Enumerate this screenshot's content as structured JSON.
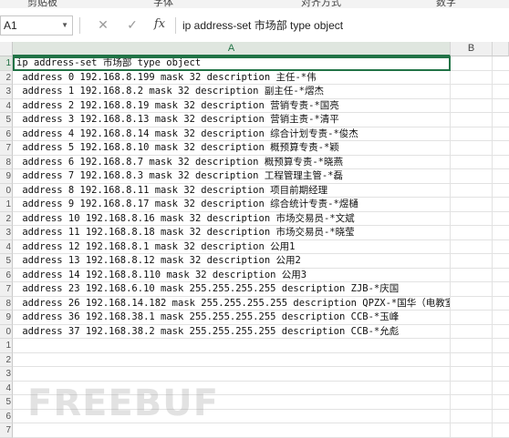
{
  "ribbon": {
    "fragments": [
      "剪贴板",
      "字体",
      "对齐方式",
      "数字"
    ]
  },
  "formula_bar": {
    "name_box": "A1",
    "formula": "ip address-set 市场部 type object"
  },
  "columns": [
    "A",
    "B"
  ],
  "rows": [
    {
      "num": "1",
      "a": "ip address-set 市场部 type object"
    },
    {
      "num": "2",
      "a": " address 0 192.168.8.199 mask 32 description 主任-*伟"
    },
    {
      "num": "3",
      "a": " address 1 192.168.8.2 mask 32 description 副主任-*熠杰"
    },
    {
      "num": "4",
      "a": " address 2 192.168.8.19 mask 32 description 营销专责-*国亮"
    },
    {
      "num": "5",
      "a": " address 3 192.168.8.13 mask 32 description 营销主责-*清平"
    },
    {
      "num": "6",
      "a": " address 4 192.168.8.14 mask 32 description 综合计划专责-*俊杰"
    },
    {
      "num": "7",
      "a": " address 5 192.168.8.10 mask 32 description 概预算专责-*颖"
    },
    {
      "num": "8",
      "a": " address 6 192.168.8.7 mask 32 description 概预算专责-*晓燕"
    },
    {
      "num": "9",
      "a": " address 7 192.168.8.3 mask 32 description 工程管理主管-*磊"
    },
    {
      "num": "0",
      "a": " address 8 192.168.8.11 mask 32 description 项目前期经理"
    },
    {
      "num": "1",
      "a": " address 9 192.168.8.17 mask 32 description 综合统计专责-*煜樋"
    },
    {
      "num": "2",
      "a": " address 10 192.168.8.16 mask 32 description 市场交易员-*文斌"
    },
    {
      "num": "3",
      "a": " address 11 192.168.8.18 mask 32 description 市场交易员-*晓莹"
    },
    {
      "num": "4",
      "a": " address 12 192.168.8.1 mask 32 description 公用1"
    },
    {
      "num": "5",
      "a": " address 13 192.168.8.12 mask 32 description 公用2"
    },
    {
      "num": "6",
      "a": " address 14 192.168.8.110 mask 32 description 公用3"
    },
    {
      "num": "7",
      "a": " address 23 192.168.6.10 mask 255.255.255.255 description ZJB-*庆国"
    },
    {
      "num": "8",
      "a": " address 26 192.168.14.182 mask 255.255.255.255 description QPZX-*国华（电教室）"
    },
    {
      "num": "9",
      "a": " address 36 192.168.38.1 mask 255.255.255.255 description CCB-*玉峰"
    },
    {
      "num": "0",
      "a": " address 37 192.168.38.2 mask 255.255.255.255 description CCB-*允彪"
    },
    {
      "num": "1",
      "a": ""
    },
    {
      "num": "2",
      "a": ""
    },
    {
      "num": "3",
      "a": ""
    },
    {
      "num": "4",
      "a": ""
    },
    {
      "num": "5",
      "a": ""
    },
    {
      "num": "6",
      "a": ""
    },
    {
      "num": "7",
      "a": ""
    }
  ],
  "watermark": "FREEBUF",
  "colors": {
    "excel_green": "#217346"
  }
}
